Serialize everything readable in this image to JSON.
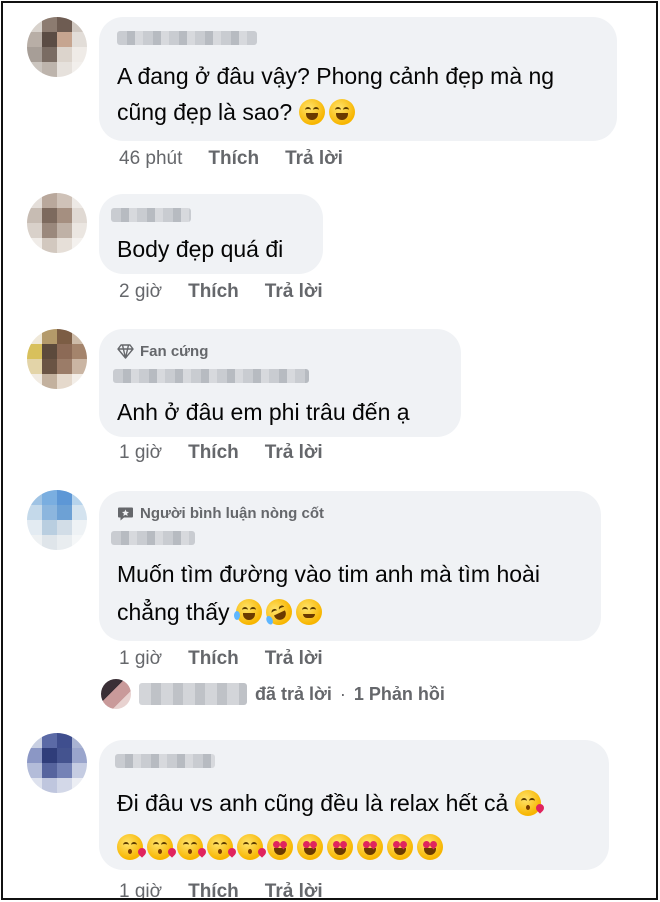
{
  "comments": [
    {
      "badge": "",
      "lines": [
        "A đang ở đâu vậy? Phong cảnh đẹp mà ng",
        "cũng đẹp là sao?"
      ],
      "emoji_line2": [
        "grin-squint",
        "grin-squint"
      ],
      "time": "46 phút",
      "like": "Thích",
      "reply": "Trả lời"
    },
    {
      "badge": "",
      "lines": [
        "Body đẹp quá đi"
      ],
      "time": "2 giờ",
      "like": "Thích",
      "reply": "Trả lời"
    },
    {
      "badge": "Fan cứng",
      "badge_icon": "diamond-icon",
      "lines": [
        "Anh ở đâu em phi trâu đến ạ"
      ],
      "time": "1 giờ",
      "like": "Thích",
      "reply": "Trả lời"
    },
    {
      "badge": "Người bình luận nòng cốt",
      "badge_icon": "comment-badge-icon",
      "lines": [
        "Muốn tìm đường vào tim anh mà tìm hoài",
        "chẳng thấy"
      ],
      "emoji_line2": [
        "tears-of-joy",
        "rofl",
        "smiling-blush"
      ],
      "time": "1 giờ",
      "like": "Thích",
      "reply": "Trả lời",
      "replies_summary": {
        "action": "đã trả lời",
        "separator": "·",
        "count_label": "1 Phản hồi"
      }
    },
    {
      "badge": "",
      "lines": [
        "Đi đâu vs anh cũng đều là relax hết cả"
      ],
      "emoji_line1": [
        "kissing-heart"
      ],
      "emoji_line2": [
        "kissing-heart",
        "kissing-heart",
        "kissing-heart",
        "kissing-heart",
        "kissing-heart",
        "heart-eyes",
        "heart-eyes",
        "heart-eyes",
        "heart-eyes",
        "heart-eyes",
        "heart-eyes"
      ],
      "time": "1 giờ",
      "like": "Thích",
      "reply": "Trả lời"
    }
  ]
}
